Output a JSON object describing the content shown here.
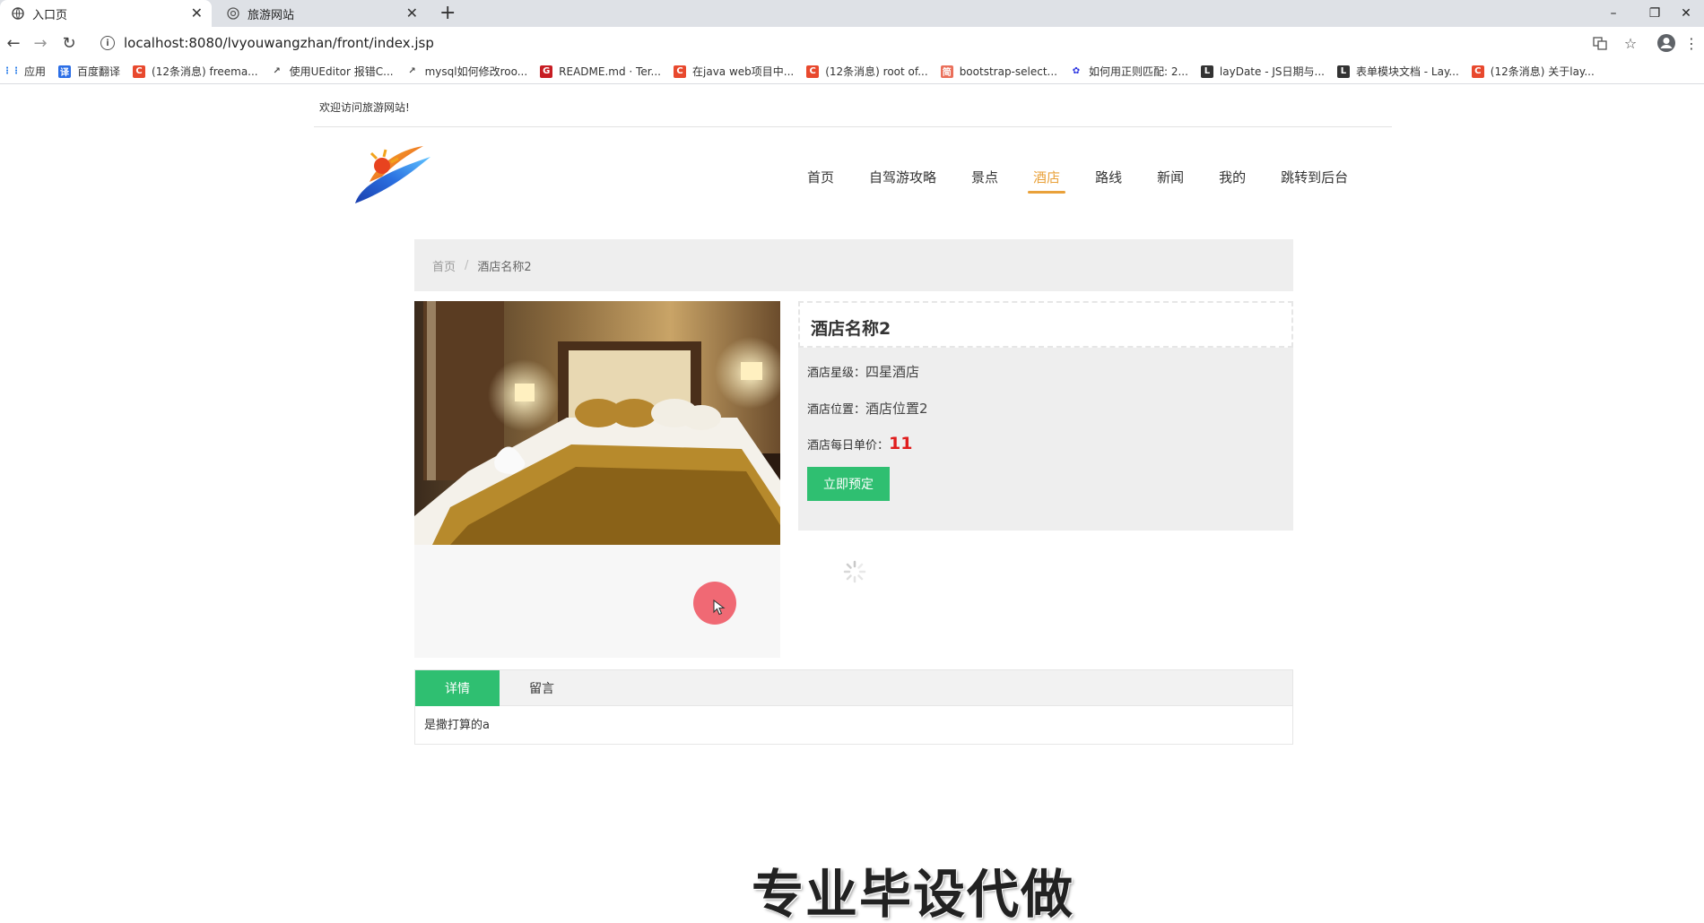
{
  "browser": {
    "tabs": [
      {
        "title": "入口页",
        "active": true,
        "icon": "globe-icon"
      },
      {
        "title": "旅游网站",
        "active": false,
        "icon": "site-icon"
      }
    ],
    "url": "localhost:8080/lvyouwangzhan/front/index.jsp",
    "bookmarks": [
      {
        "label": "应用",
        "icon": "apps-grid-icon",
        "color": "#1a73e8"
      },
      {
        "label": "百度翻译",
        "icon": "baidu-translate-icon",
        "color": "#2b6ee6"
      },
      {
        "label": "(12条消息) freema...",
        "icon": "csdn-icon",
        "color": "#e8492e"
      },
      {
        "label": "使用UEditor 报错C...",
        "icon": "link-icon",
        "color": "#444444"
      },
      {
        "label": "mysql如何修改roo...",
        "icon": "link-icon",
        "color": "#444444"
      },
      {
        "label": "README.md · Ter...",
        "icon": "gitee-icon",
        "color": "#c71d23"
      },
      {
        "label": "在java web项目中...",
        "icon": "csdn-icon",
        "color": "#e8492e"
      },
      {
        "label": "(12条消息) root of...",
        "icon": "csdn-icon",
        "color": "#e8492e"
      },
      {
        "label": "bootstrap-select...",
        "icon": "jianshu-icon",
        "color": "#ea6f5a"
      },
      {
        "label": "如何用正则匹配: 2...",
        "icon": "baidu-icon",
        "color": "#2932e1"
      },
      {
        "label": "layDate - JS日期与...",
        "icon": "layui-icon",
        "color": "#333333"
      },
      {
        "label": "表单模块文档 - Lay...",
        "icon": "layui-icon",
        "color": "#333333"
      },
      {
        "label": "(12条消息) 关于lay...",
        "icon": "csdn-icon",
        "color": "#e8492e"
      }
    ]
  },
  "site": {
    "welcome": "欢迎访问旅游网站!",
    "nav": [
      {
        "label": "首页",
        "active": false
      },
      {
        "label": "自驾游攻略",
        "active": false
      },
      {
        "label": "景点",
        "active": false
      },
      {
        "label": "酒店",
        "active": true
      },
      {
        "label": "路线",
        "active": false
      },
      {
        "label": "新闻",
        "active": false
      },
      {
        "label": "我的",
        "active": false
      },
      {
        "label": "跳转到后台",
        "active": false
      }
    ],
    "accent_color": "#e9a13a",
    "green_color": "#2fbf71"
  },
  "breadcrumb": {
    "home": "首页",
    "separator": "/",
    "current": "酒店名称2"
  },
  "hotel": {
    "name": "酒店名称2",
    "star_label": "酒店星级：",
    "star_value": "四星酒店",
    "location_label": "酒店位置：",
    "location_value": "酒店位置2",
    "price_label": "酒店每日单价：",
    "price_value": "11",
    "book_button": "立即预定"
  },
  "detail_tabs": {
    "tabs": [
      {
        "label": "详情",
        "active": true
      },
      {
        "label": "留言",
        "active": false
      }
    ],
    "content": "是撒打算的a"
  },
  "overlay": {
    "watermark": "专业毕设代做"
  }
}
